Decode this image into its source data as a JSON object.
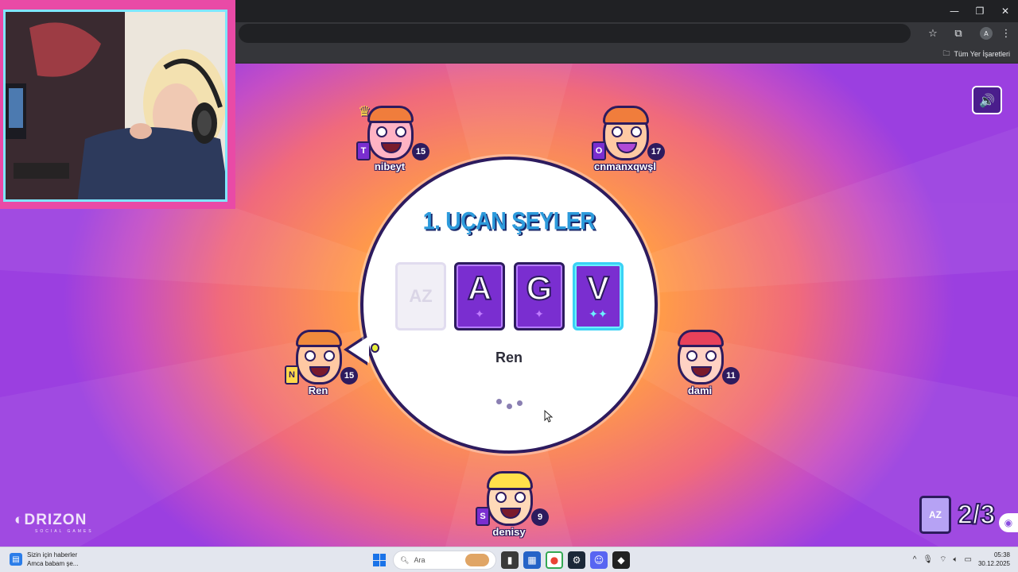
{
  "browser": {
    "bookmarks_all_label": "Tüm Yer İşaretleri",
    "window_controls": [
      "—",
      "❐",
      "✕"
    ]
  },
  "game": {
    "round_title": "1. UÇAN ŞEYLER",
    "cards": [
      {
        "letter": "AZ",
        "style": "empty"
      },
      {
        "letter": "A",
        "style": "purple",
        "spark": "✦"
      },
      {
        "letter": "G",
        "style": "purple",
        "spark": "✦"
      },
      {
        "letter": "V",
        "style": "blue",
        "spark": "✦✦"
      }
    ],
    "current_player": "Ren",
    "round_counter": "2/3",
    "round_counter_card": "AZ",
    "brand_logo": "◐DRIZON",
    "brand_sub": "SOCIAL GAMES",
    "sound_icon": "🔊"
  },
  "players": [
    {
      "name": "nibeyt",
      "score": "15",
      "card": "T",
      "hair": "#f07d3c",
      "skin": "#ffb3c4",
      "crown": true
    },
    {
      "name": "cnmanxqwşl",
      "score": "17",
      "card": "O",
      "hair": "#f07d3c",
      "skin": "#ffc9a3",
      "crown": false
    },
    {
      "name": "Ren",
      "score": "15",
      "card": "N",
      "hair": "#f08a3c",
      "skin": "#ffc9a3",
      "crown": false
    },
    {
      "name": "dami",
      "score": "11",
      "card": "",
      "hair": "#e8415a",
      "skin": "#ffd2c4",
      "crown": false
    },
    {
      "name": "denisy",
      "score": "9",
      "card": "S",
      "hair": "#ffe04a",
      "skin": "#ffd9b8",
      "crown": false
    }
  ],
  "taskbar": {
    "news_title": "Sizin için haberler",
    "news_sub": "Amca babam şe...",
    "search_placeholder": "Ara",
    "time": "05:38",
    "date": "30.12.2025"
  }
}
